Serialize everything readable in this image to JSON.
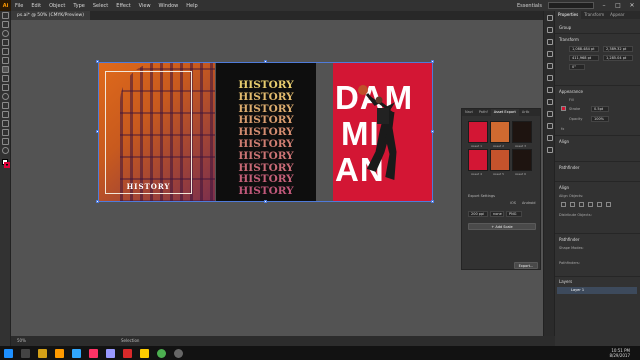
{
  "app": {
    "logo": "Ai",
    "menu": [
      "File",
      "Edit",
      "Object",
      "Type",
      "Select",
      "Effect",
      "View",
      "Window",
      "Help"
    ],
    "workspace": "Essentials"
  },
  "document_tab": "ps.ai* @ 50% (CMYK/Preview)",
  "artboards": {
    "colosseum": {
      "title": "HISTORY"
    },
    "history_list": {
      "lines": [
        "HISTORY",
        "HISTORY",
        "HISTORY",
        "HISTORY",
        "HISTORY",
        "HISTORY",
        "HISTORY",
        "HISTORY",
        "HISTORY",
        "HISTORY"
      ],
      "colors": [
        "#e8cd6e",
        "#e2bb6e",
        "#dcac6e",
        "#d89c6e",
        "#d48c70",
        "#d07e72",
        "#cc7474",
        "#c86a76",
        "#c46078",
        "#c0587a"
      ]
    },
    "damian": {
      "word_top": "DAM",
      "word_mid": "MI",
      "word_bot": "AN"
    }
  },
  "asset_panel": {
    "tabs": [
      "Navi",
      "Pathf",
      "Asset Export",
      "Artb"
    ],
    "assets": [
      {
        "label": "Asset 1",
        "color": "#d31634"
      },
      {
        "label": "Asset 2",
        "color": "#d06a30"
      },
      {
        "label": "Asset 3",
        "color": "#1e1410"
      },
      {
        "label": "Asset 4",
        "color": "#d31634"
      },
      {
        "label": "Asset 5",
        "color": "#c4532c"
      },
      {
        "label": "Asset 6",
        "color": "#1e1410"
      }
    ],
    "export_settings_label": "Export Settings",
    "ios_label": "iOS",
    "android_label": "Android",
    "scale_value": "200 ppi",
    "suffix_value": "none",
    "format_value": "PNG",
    "add_scale_label": "+ Add Scale",
    "export_button": "Export..."
  },
  "properties": {
    "tabs": [
      "Properties",
      "Transform",
      "Appear"
    ],
    "section_group": "Group",
    "section_transform": "Transform",
    "x_value": "1,088.484 pt",
    "y_value": "411,968 pt",
    "w_value": "2,389.32 pt",
    "h_value": "1,285.04 pt",
    "angle_value": "0°",
    "section_appearance": "Appearance",
    "fill_label": "Fill",
    "stroke_label": "Stroke",
    "stroke_value": "0.5pt",
    "opacity_label": "Opacity",
    "opacity_value": "100%",
    "fx_label": "fx",
    "section_align": "Align",
    "section_pathfinder": "Pathfinder",
    "section_align2": "Align",
    "align_objects_label": "Align Objects:",
    "distribute_label": "Distribute Objects:",
    "section_pathfinder2": "Pathfinder",
    "shape_modes": "Shape Modes:",
    "pathfinders": "Pathfinders:",
    "section_layers": "Layers",
    "layer_name": "Layer 1"
  },
  "status": {
    "zoom": "50%",
    "mode": "Selection"
  },
  "taskbar": {
    "time": "10:51 PM",
    "date": "8/29/2017"
  }
}
